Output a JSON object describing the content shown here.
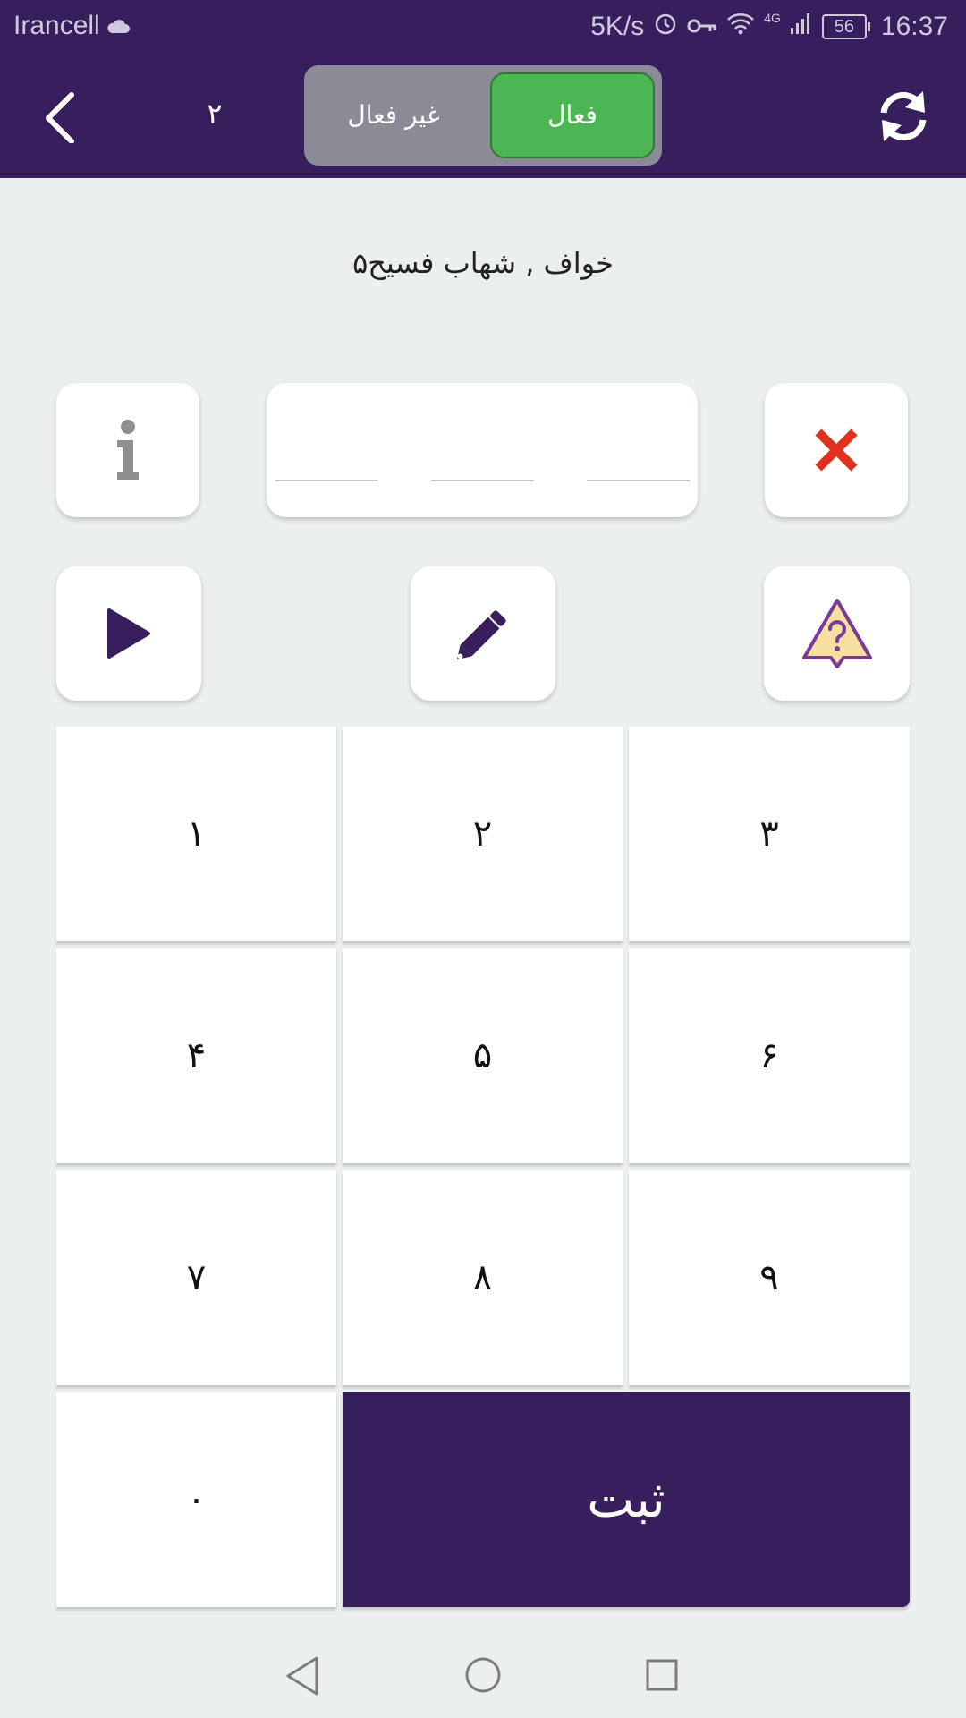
{
  "status_bar": {
    "carrier": "Irancell",
    "speed": "5K/s",
    "network": "4G",
    "battery": "56",
    "time": "16:37"
  },
  "header": {
    "back_icon": "chevron-left-icon",
    "counter": "۲",
    "toggle": {
      "inactive_label": "غیر فعال",
      "active_label": "فعال",
      "selected": "فعال"
    },
    "refresh_icon": "refresh-icon"
  },
  "subtitle": "خواف , شهاب فسیح۵",
  "actions": {
    "info_icon": "info-icon",
    "clear_icon": "close-icon",
    "play_icon": "play-icon",
    "edit_icon": "pencil-icon",
    "report_icon": "warning-question-icon"
  },
  "code_input": {
    "slots": [
      "",
      "",
      ""
    ]
  },
  "keypad": {
    "keys": [
      "۱",
      "۲",
      "۳",
      "۴",
      "۵",
      "۶",
      "۷",
      "۸",
      "۹",
      "۰"
    ],
    "submit_label": "ثبت"
  },
  "colors": {
    "primary": "#361f5c",
    "active_green": "#4cb652",
    "toggle_bg": "#8a8b96",
    "danger": "#e0301e",
    "warning_fill": "#f6e0a0",
    "warning_stroke": "#7a3a9a",
    "background": "#eceff0"
  }
}
